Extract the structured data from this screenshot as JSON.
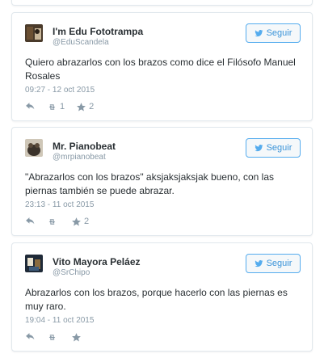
{
  "tweets": [
    {
      "name": "I'm Edu Fototrampa",
      "handle": "@EduScandela",
      "follow_label": "Seguir",
      "text": "Quiero abrazarlos con los brazos como dice el Filósofo Manuel Rosales",
      "time": "09:27 - 12 oct 2015",
      "retweets": "1",
      "likes": "2"
    },
    {
      "name": "Mr. Pianobeat",
      "handle": "@mrpianobeat",
      "follow_label": "Seguir",
      "text": "\"Abrazarlos con los brazos\" aksjaksjaksjak bueno, con las piernas también se puede abrazar.",
      "time": "23:13 - 11 oct 2015",
      "retweets": "",
      "likes": "2"
    },
    {
      "name": "Vito Mayora Peláez",
      "handle": "@SrChipo",
      "follow_label": "Seguir",
      "text": "Abrazarlos con los brazos, porque hacerlo con las piernas es muy raro.",
      "time": "19:04 - 11 oct 2015",
      "retweets": "",
      "likes": ""
    }
  ],
  "colors": {
    "accent": "#55acee",
    "muted": "#8899a6",
    "text": "#292f33",
    "border": "#e1e8ed"
  },
  "icons": [
    "twitter-bird-icon",
    "reply-icon",
    "retweet-icon",
    "favorite-star-icon"
  ]
}
